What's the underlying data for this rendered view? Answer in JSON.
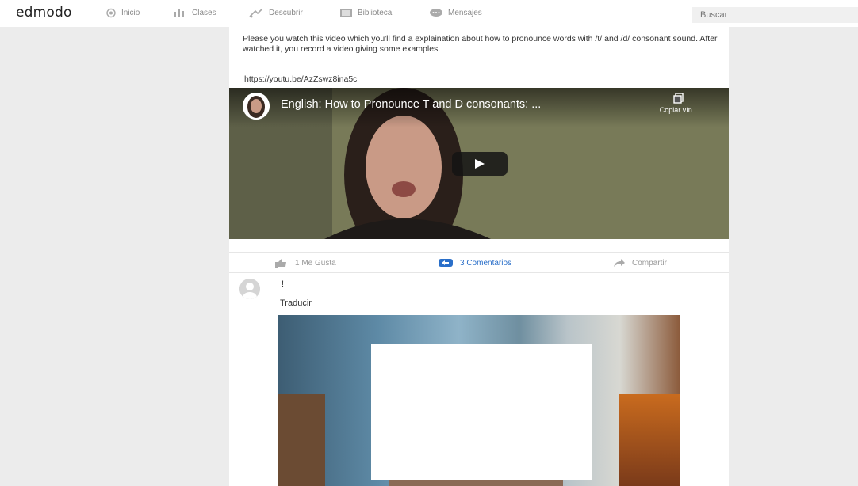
{
  "app": {
    "logo": "edmodo"
  },
  "nav": {
    "items": [
      {
        "label": "Inicio",
        "icon": "home-icon"
      },
      {
        "label": "Clases",
        "icon": "classes-icon"
      },
      {
        "label": "Descubrir",
        "icon": "discover-icon"
      },
      {
        "label": "Biblioteca",
        "icon": "library-icon"
      },
      {
        "label": "Mensajes",
        "icon": "messages-icon"
      }
    ]
  },
  "search": {
    "placeholder": "Buscar"
  },
  "post": {
    "text": "Please you watch this video which you'll find a explaination about how to pronounce words with /t/ and /d/ consonant sound. After watched it, you record a video giving some examples.",
    "link": "https://youtu.be/AzZswz8ina5c",
    "video": {
      "title": "English: How to Pronounce T and D consonants: ...",
      "copy_label": "Copiar vín..."
    },
    "actions": {
      "like": "1 Me Gusta",
      "comments": "3 Comentarios",
      "share": "Compartir"
    }
  },
  "comment": {
    "author": "!",
    "translate": "Traducir"
  },
  "colors": {
    "accent": "#2a6fc9",
    "background": "#ececec"
  }
}
